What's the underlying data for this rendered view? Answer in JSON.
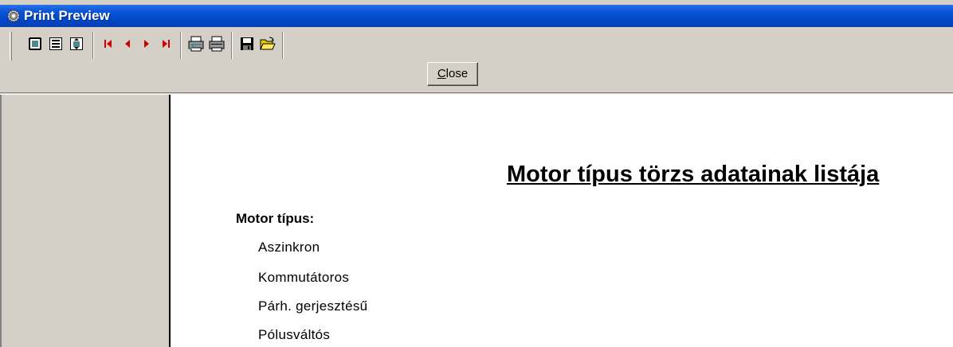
{
  "window": {
    "title": "Print Preview"
  },
  "toolbar": {
    "buttons": [
      {
        "name": "one-page-button",
        "icon": "one-page-icon"
      },
      {
        "name": "two-pages-button",
        "icon": "two-pages-icon"
      },
      {
        "name": "zoom-button",
        "icon": "zoom-icon"
      },
      {
        "name": "first-page-button",
        "icon": "first-page-icon"
      },
      {
        "name": "previous-page-button",
        "icon": "previous-page-icon"
      },
      {
        "name": "next-page-button",
        "icon": "next-page-icon"
      },
      {
        "name": "last-page-button",
        "icon": "last-page-icon"
      },
      {
        "name": "print-setup-button",
        "icon": "printer-setup-icon"
      },
      {
        "name": "print-button",
        "icon": "printer-icon"
      },
      {
        "name": "save-button",
        "icon": "floppy-disk-icon"
      },
      {
        "name": "open-button",
        "icon": "open-folder-icon"
      }
    ],
    "close_label": "Close"
  },
  "report": {
    "title": "Motor típus törzs adatainak listája",
    "group_label": "Motor típus:",
    "items": [
      "Aszinkron",
      "Kommutátoros",
      "Párh. gerjesztésű",
      "Pólusváltós"
    ]
  },
  "colors": {
    "titlebar": "#0047c8",
    "nav_arrow": "#cc0000",
    "panel": "#d4d0c8"
  }
}
